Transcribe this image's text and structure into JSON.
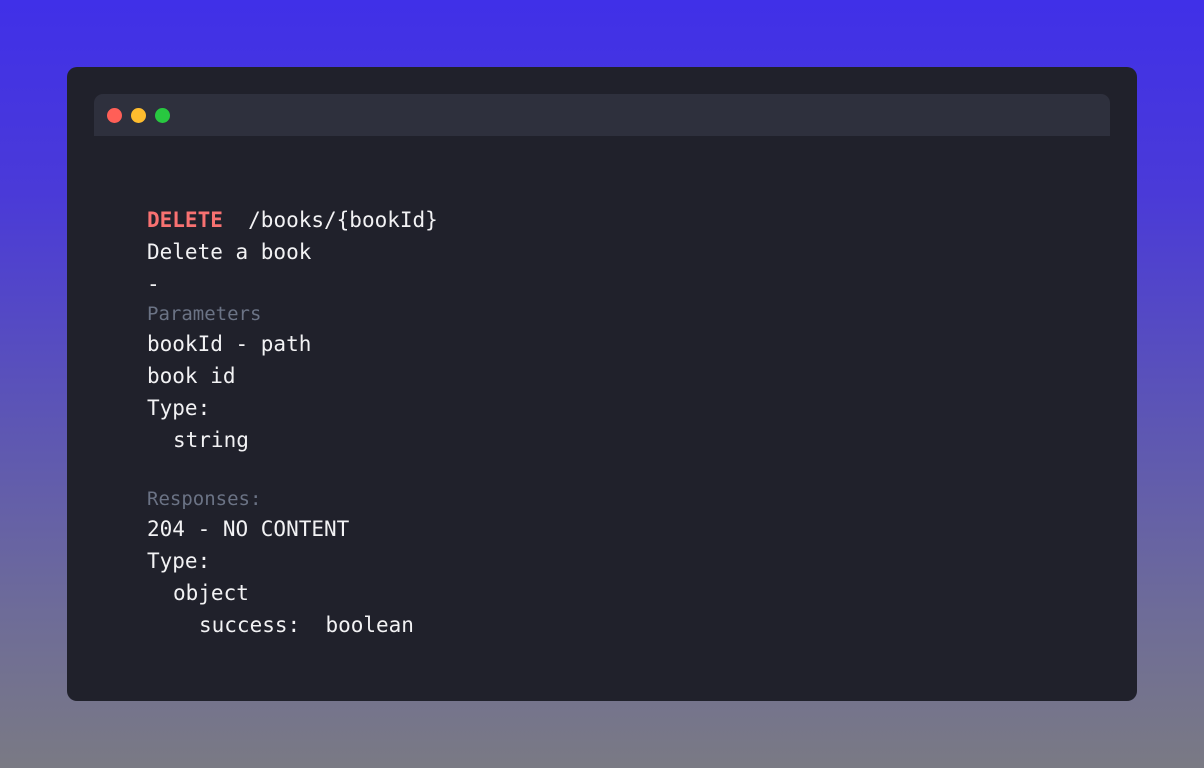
{
  "window": {
    "controls": {
      "close_color": "#ff5f57",
      "minimize_color": "#febc2e",
      "maximize_color": "#28c840"
    }
  },
  "endpoint": {
    "method": "DELETE",
    "path": "/books/{bookId}",
    "summary": "Delete a book",
    "separator": "-"
  },
  "parameters": {
    "heading": "Parameters",
    "name_line": "bookId - path",
    "description": "book id",
    "type_label": "Type:",
    "type_value": "string"
  },
  "responses": {
    "heading": "Responses:",
    "status_line": "204 - NO CONTENT",
    "type_label": "Type:",
    "type_value": "object",
    "field_name": "success:",
    "field_type": "boolean"
  },
  "colors": {
    "method": "#f87171",
    "section_heading": "#6b7385",
    "text": "#f2f2f4",
    "panel": "#20212b",
    "titlebar": "#2e303d"
  }
}
